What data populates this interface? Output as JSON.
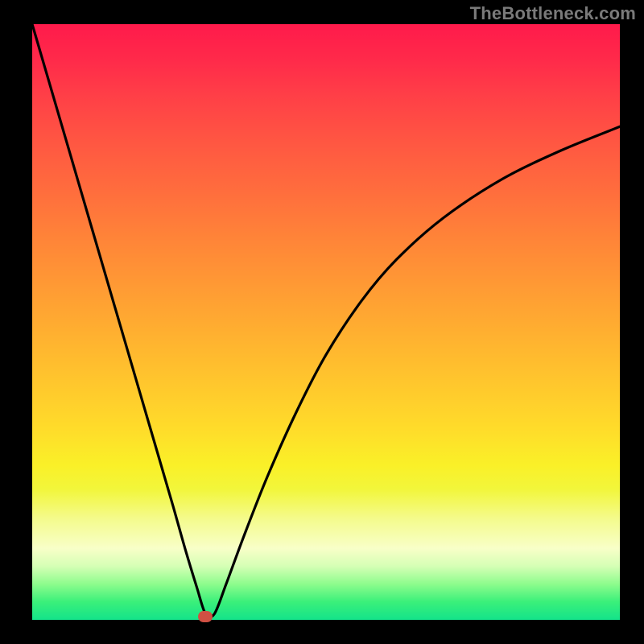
{
  "watermark": "TheBottleneck.com",
  "colors": {
    "frame": "#000000",
    "marker": "#d05043",
    "curve": "#000000",
    "watermark": "#7a7a7a"
  },
  "chart_data": {
    "type": "line",
    "title": "",
    "xlabel": "",
    "ylabel": "",
    "xlim": [
      0,
      100
    ],
    "ylim": [
      0,
      100
    ],
    "series": [
      {
        "name": "bottleneck-curve",
        "x": [
          0,
          4,
          8,
          12,
          16,
          20,
          24,
          26,
          28,
          29.5,
          31,
          33,
          36,
          40,
          45,
          50,
          56,
          62,
          70,
          80,
          90,
          100
        ],
        "y": [
          100,
          86.5,
          73,
          59.5,
          46,
          32.5,
          19,
          12,
          5.5,
          1,
          1,
          6,
          14,
          24,
          35,
          44.5,
          53.5,
          60.5,
          67.5,
          74,
          78.8,
          82.8
        ]
      }
    ],
    "marker": {
      "x": 29.5,
      "y": 0.6
    },
    "grid": false,
    "legend": false
  }
}
